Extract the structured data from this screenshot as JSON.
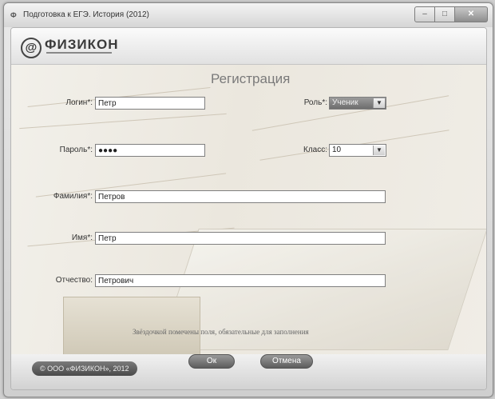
{
  "window": {
    "title": "Подготовка к ЕГЭ. История (2012)",
    "app_icon": "app-logo-icon",
    "controls": {
      "minimize": "–",
      "maximize": "□",
      "close": "✕"
    }
  },
  "logo": {
    "text": "ФИЗИКОН"
  },
  "form": {
    "title": "Регистрация",
    "login_label": "Логин*:",
    "login_value": "Петр",
    "role_label": "Роль*:",
    "role_value": "Ученик",
    "password_label": "Пароль*:",
    "password_value": "●●●●",
    "class_label": "Класс:",
    "class_value": "10",
    "surname_label": "Фамилия*:",
    "surname_value": "Петров",
    "name_label": "Имя*:",
    "name_value": "Петр",
    "patronymic_label": "Отчество:",
    "patronymic_value": "Петрович",
    "required_note": "Звёздочкой помечены поля, обязательные для заполнения"
  },
  "buttons": {
    "ok": "Ок",
    "cancel": "Отмена"
  },
  "footer": {
    "copyright": "© ООО «ФИЗИКОН», 2012"
  }
}
